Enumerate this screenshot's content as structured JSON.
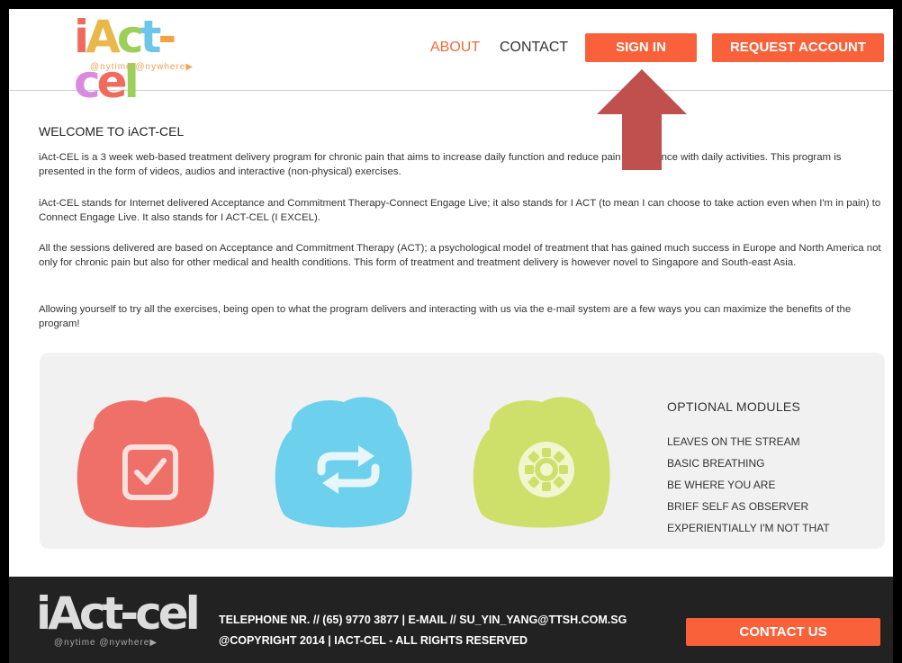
{
  "header": {
    "logo": {
      "text": "iAct-cel",
      "tagline": "@nytime @nywhere▶"
    },
    "nav": {
      "about": "ABOUT",
      "contact": "CONTACT"
    },
    "sign_in": "SIGN IN",
    "request_account": "REQUEST ACCOUNT"
  },
  "welcome": {
    "title": "WELCOME TO iACT-CEL",
    "paragraphs": [
      "iAct-CEL is a 3 week web-based treatment delivery program for chronic pain that aims to increase daily function and reduce pain interference with daily activities. This program is presented in the form of videos, audios and interactive (non-physical) exercises.",
      "iAct-CEL stands for Internet delivered Acceptance and Commitment Therapy-Connect Engage Live; it also stands for I ACT (to mean I can choose to take action even when I'm in pain) to Connect Engage Live. It also stands for I ACT-CEL (I EXCEL).",
      "All the sessions delivered are based on Acceptance and Commitment Therapy (ACT); a psychological model of treatment that has gained much success in Europe and North America not only for chronic pain but also for other medical and health conditions. This form of treatment and treatment delivery is however novel to Singapore and South-east Asia.",
      "Allowing yourself to try all the exercises, being open to what the program delivers and interacting with us via the e-mail system are a few ways you can maximize the benefits of the program!"
    ]
  },
  "modules": {
    "icons": [
      {
        "name": "checkbox-icon",
        "color": "#ef7069"
      },
      {
        "name": "refresh-icon",
        "color": "#6dd0ec"
      },
      {
        "name": "gear-icon",
        "color": "#cfe06a"
      }
    ],
    "title": "OPTIONAL MODULES",
    "items": [
      "LEAVES ON THE STREAM",
      "BASIC BREATHING",
      "BE WHERE YOU ARE",
      "BRIEF SELF AS OBSERVER",
      "EXPERIENTIALLY I'M NOT THAT"
    ]
  },
  "footer": {
    "logo": {
      "text": "iAct-cel",
      "tagline": "@nytime @nywhere▶"
    },
    "contact_line": "TELEPHONE NR. // (65) 9770 3877 | E-MAIL // SU_YIN_YANG@TTSH.COM.SG",
    "copyright": "@COPYRIGHT 2014 | IACT-CEL - ALL RIGHTS RESERVED",
    "contact_us": "CONTACT US"
  },
  "colors": {
    "accent": "#f9613a",
    "arrow": "#c0504d",
    "footer_bg": "#222222"
  }
}
